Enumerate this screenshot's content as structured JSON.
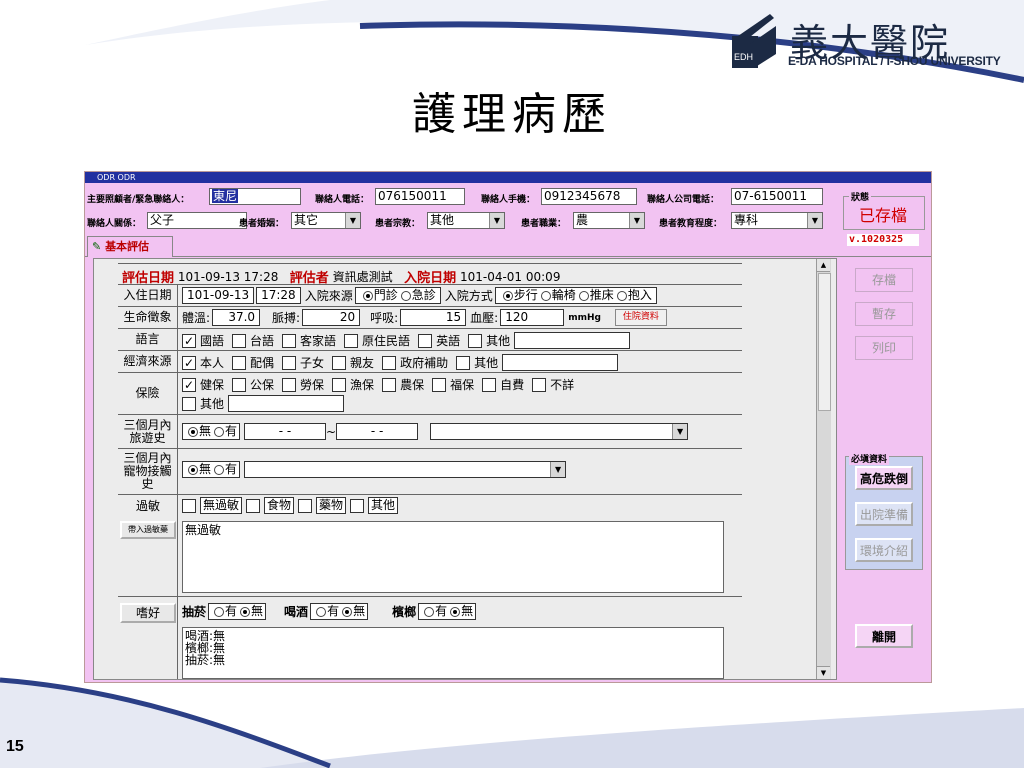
{
  "slide": {
    "title": "護理病歷",
    "page_number": "15",
    "logo_cn": "義大醫院",
    "logo_en": "E-DA HOSPITAL / I-SHOU UNIVERSITY",
    "logo_mark": "EDH"
  },
  "app": {
    "window_title": "ODR ODR",
    "header": {
      "contact_label": "主要照顧者/緊急聯絡人：",
      "contact_value": "東尼",
      "phone_label": "聯絡人電話：",
      "phone_value": "076150011",
      "mobile_label": "聯絡人手機：",
      "mobile_value": "0912345678",
      "company_phone_label": "聯絡人公司電話：",
      "company_phone_value": "07-6150011",
      "relation_label": "聯絡人關係：",
      "relation_value": "父子",
      "marital_label": "患者婚姻：",
      "marital_value": "其它",
      "religion_label": "患者宗教：",
      "religion_value": "其他",
      "occupation_label": "患者職業：",
      "occupation_value": "農",
      "education_label": "患者教育程度：",
      "education_value": "專科"
    },
    "status": {
      "label": "狀態",
      "value": "已存檔",
      "version": "v.1020325"
    },
    "tab": {
      "label": "基本評估"
    },
    "side_buttons": {
      "save": "存檔",
      "temp_save": "暫存",
      "print": "列印",
      "required_label": "必塡資料",
      "fall_risk": "高危跌倒",
      "discharge_prep": "出院準備",
      "env_intro": "環境介紹",
      "leave": "離開"
    },
    "form": {
      "assess_date_label": "評估日期",
      "assess_date_value": "101-09-13 17:28",
      "assessor_label": "評估者",
      "assessor_value": "資訊處測試",
      "admit_date_label": "入院日期",
      "admit_date_value": "101-04-01 00:09",
      "ward_in_label": "入住日期",
      "ward_in_date": "101-09-13",
      "ward_in_time": "17:28",
      "admit_source_label": "入院來源",
      "admit_source_opts": [
        "門診",
        "急診"
      ],
      "admit_method_label": "入院方式",
      "admit_method_opts": [
        "步行",
        "輪椅",
        "推床",
        "抱入"
      ],
      "vitals_label": "生命徵象",
      "temp_label": "體溫:",
      "temp_value": "37.0",
      "pulse_label": "脈搏:",
      "pulse_value": "20",
      "resp_label": "呼吸:",
      "resp_value": "15",
      "bp_label": "血壓:",
      "bp_value": "120",
      "bp_unit": "mmHg",
      "vitals_btn": "住院資料",
      "lang_label": "語言",
      "lang_opts": [
        "國語",
        "台語",
        "客家語",
        "原住民語",
        "英語",
        "其他"
      ],
      "econ_label": "經濟來源",
      "econ_opts": [
        "本人",
        "配偶",
        "子女",
        "親友",
        "政府補助",
        "其他"
      ],
      "ins_label": "保險",
      "ins_opts": [
        "健保",
        "公保",
        "勞保",
        "漁保",
        "農保",
        "福保",
        "自費",
        "不詳",
        "其他"
      ],
      "travel_label": "三個月內旅遊史",
      "travel_opts": [
        "無",
        "有"
      ],
      "travel_from": "- -",
      "travel_tilde": "~",
      "travel_to": "- -",
      "pet_label": "三個月內寵物接觸史",
      "pet_opts": [
        "無",
        "有"
      ],
      "allergy_label": "過敏",
      "allergy_opts": [
        "無過敏",
        "食物",
        "藥物",
        "其他"
      ],
      "allergy_btn": "帶入過敏藥",
      "allergy_text": "無過敏",
      "habit_label": "嗜好",
      "smoke_label": "抽菸",
      "drink_label": "喝酒",
      "betel_label": "檳榔",
      "yes_no": [
        "有",
        "無"
      ],
      "habit_text": "喝酒:無\n檳榔:無\n抽菸:無"
    }
  }
}
